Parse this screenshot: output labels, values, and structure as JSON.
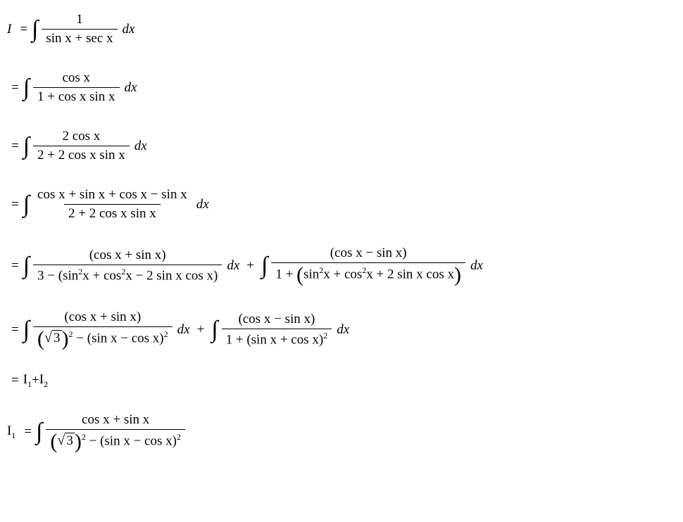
{
  "line1": {
    "lhs": "I",
    "num": "1",
    "den": "sin x + sec x",
    "dx": "dx"
  },
  "line2": {
    "num": "cos x",
    "den": "1 + cos x sin x",
    "dx": "dx"
  },
  "line3": {
    "num": "2 cos x",
    "den": "2 + 2 cos x sin x",
    "dx": "dx"
  },
  "line4": {
    "num": "cos x + sin x + cos x − sin x",
    "den": "2 + 2 cos x sin x",
    "dx": "dx"
  },
  "line5": {
    "a": {
      "num": "(cos x + sin x)",
      "den_pre": "3 − (sin",
      "den_mid1": "x + cos",
      "den_mid2": "x − 2 sin x cos x)",
      "sup": "2",
      "dx": "dx"
    },
    "b": {
      "num": "(cos x − sin x)",
      "den_pre": "1 + ",
      "den_left": "sin",
      "den_mid1": "x + cos",
      "den_mid2": "x + 2 sin x cos x",
      "sup": "2",
      "dx": "dx"
    }
  },
  "line6": {
    "a": {
      "num": "(cos x + sin x)",
      "sqrt": "3",
      "den_tail": " − (sin x − cos x)",
      "dx": "dx"
    },
    "b": {
      "num": "(cos x − sin x)",
      "den": "1 + (sin x + cos x)",
      "dx": "dx"
    }
  },
  "line7": {
    "text_pre": "I",
    "sub1": "1",
    "plus": " + ",
    "text_pre2": "I",
    "sub2": "2"
  },
  "line8": {
    "lhs_pre": "I",
    "lhs_sub": "1",
    "num": "cos x + sin x",
    "sqrt": "3",
    "den_tail": " − (sin x − cos x)"
  },
  "sym": {
    "eq": "=",
    "int": "∫",
    "plus": "+",
    "two": "2"
  }
}
